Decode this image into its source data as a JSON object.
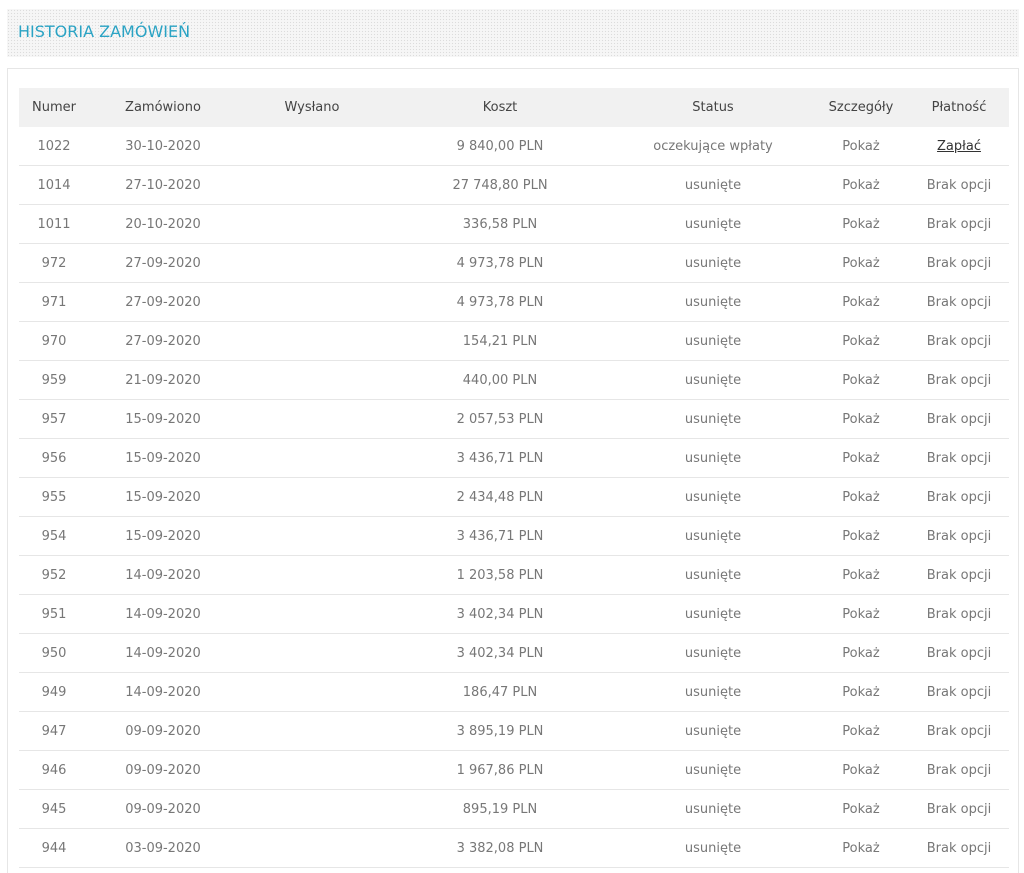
{
  "page": {
    "title": "HISTORIA ZAMÓWIEŃ"
  },
  "table": {
    "headers": {
      "number": "Numer",
      "ordered": "Zamówiono",
      "shipped": "Wysłano",
      "cost": "Koszt",
      "status": "Status",
      "details": "Szczegóły",
      "payment": "Płatność"
    },
    "rows": [
      {
        "number": "1022",
        "ordered": "30-10-2020",
        "shipped": "",
        "cost": "9 840,00 PLN",
        "status": "oczekujące wpłaty",
        "details": "Pokaż",
        "payment": "Zapłać",
        "payment_is_link": true
      },
      {
        "number": "1014",
        "ordered": "27-10-2020",
        "shipped": "",
        "cost": "27 748,80 PLN",
        "status": "usunięte",
        "details": "Pokaż",
        "payment": "Brak opcji",
        "payment_is_link": false
      },
      {
        "number": "1011",
        "ordered": "20-10-2020",
        "shipped": "",
        "cost": "336,58 PLN",
        "status": "usunięte",
        "details": "Pokaż",
        "payment": "Brak opcji",
        "payment_is_link": false
      },
      {
        "number": "972",
        "ordered": "27-09-2020",
        "shipped": "",
        "cost": "4 973,78 PLN",
        "status": "usunięte",
        "details": "Pokaż",
        "payment": "Brak opcji",
        "payment_is_link": false
      },
      {
        "number": "971",
        "ordered": "27-09-2020",
        "shipped": "",
        "cost": "4 973,78 PLN",
        "status": "usunięte",
        "details": "Pokaż",
        "payment": "Brak opcji",
        "payment_is_link": false
      },
      {
        "number": "970",
        "ordered": "27-09-2020",
        "shipped": "",
        "cost": "154,21 PLN",
        "status": "usunięte",
        "details": "Pokaż",
        "payment": "Brak opcji",
        "payment_is_link": false
      },
      {
        "number": "959",
        "ordered": "21-09-2020",
        "shipped": "",
        "cost": "440,00 PLN",
        "status": "usunięte",
        "details": "Pokaż",
        "payment": "Brak opcji",
        "payment_is_link": false
      },
      {
        "number": "957",
        "ordered": "15-09-2020",
        "shipped": "",
        "cost": "2 057,53 PLN",
        "status": "usunięte",
        "details": "Pokaż",
        "payment": "Brak opcji",
        "payment_is_link": false
      },
      {
        "number": "956",
        "ordered": "15-09-2020",
        "shipped": "",
        "cost": "3 436,71 PLN",
        "status": "usunięte",
        "details": "Pokaż",
        "payment": "Brak opcji",
        "payment_is_link": false
      },
      {
        "number": "955",
        "ordered": "15-09-2020",
        "shipped": "",
        "cost": "2 434,48 PLN",
        "status": "usunięte",
        "details": "Pokaż",
        "payment": "Brak opcji",
        "payment_is_link": false
      },
      {
        "number": "954",
        "ordered": "15-09-2020",
        "shipped": "",
        "cost": "3 436,71 PLN",
        "status": "usunięte",
        "details": "Pokaż",
        "payment": "Brak opcji",
        "payment_is_link": false
      },
      {
        "number": "952",
        "ordered": "14-09-2020",
        "shipped": "",
        "cost": "1 203,58 PLN",
        "status": "usunięte",
        "details": "Pokaż",
        "payment": "Brak opcji",
        "payment_is_link": false
      },
      {
        "number": "951",
        "ordered": "14-09-2020",
        "shipped": "",
        "cost": "3 402,34 PLN",
        "status": "usunięte",
        "details": "Pokaż",
        "payment": "Brak opcji",
        "payment_is_link": false
      },
      {
        "number": "950",
        "ordered": "14-09-2020",
        "shipped": "",
        "cost": "3 402,34 PLN",
        "status": "usunięte",
        "details": "Pokaż",
        "payment": "Brak opcji",
        "payment_is_link": false
      },
      {
        "number": "949",
        "ordered": "14-09-2020",
        "shipped": "",
        "cost": "186,47 PLN",
        "status": "usunięte",
        "details": "Pokaż",
        "payment": "Brak opcji",
        "payment_is_link": false
      },
      {
        "number": "947",
        "ordered": "09-09-2020",
        "shipped": "",
        "cost": "3 895,19 PLN",
        "status": "usunięte",
        "details": "Pokaż",
        "payment": "Brak opcji",
        "payment_is_link": false
      },
      {
        "number": "946",
        "ordered": "09-09-2020",
        "shipped": "",
        "cost": "1 967,86 PLN",
        "status": "usunięte",
        "details": "Pokaż",
        "payment": "Brak opcji",
        "payment_is_link": false
      },
      {
        "number": "945",
        "ordered": "09-09-2020",
        "shipped": "",
        "cost": "895,19 PLN",
        "status": "usunięte",
        "details": "Pokaż",
        "payment": "Brak opcji",
        "payment_is_link": false
      },
      {
        "number": "944",
        "ordered": "03-09-2020",
        "shipped": "",
        "cost": "3 382,08 PLN",
        "status": "usunięte",
        "details": "Pokaż",
        "payment": "Brak opcji",
        "payment_is_link": false
      }
    ]
  }
}
